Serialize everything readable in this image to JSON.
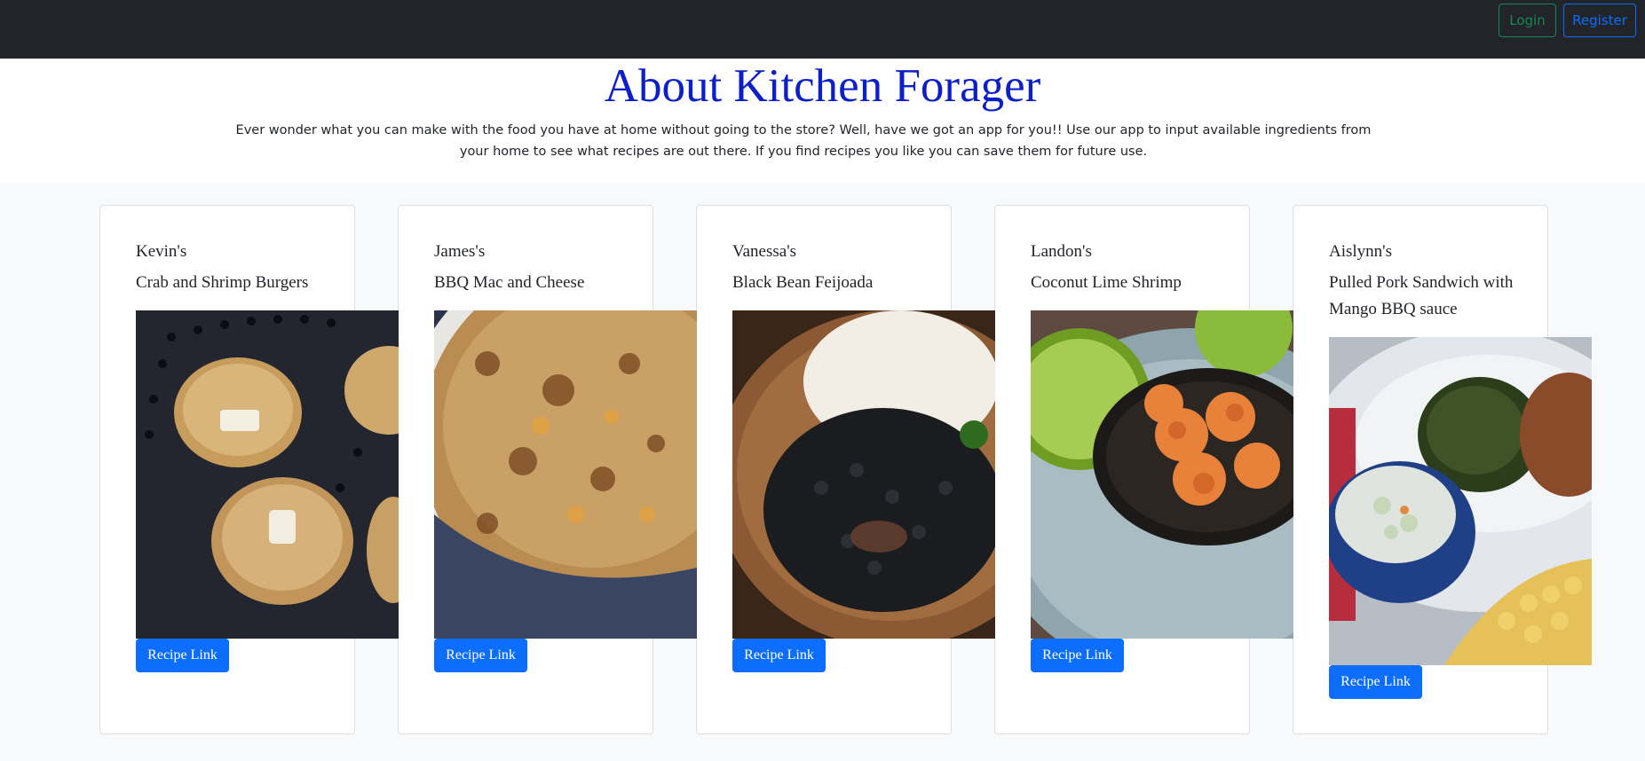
{
  "nav": {
    "login_label": "Login",
    "register_label": "Register"
  },
  "about": {
    "title": "About Kitchen Forager",
    "text": "Ever wonder what you can make with the food you have at home without going to the store? Well, have we got an app for you!! Use our app to input available ingredients from your home to see what recipes are out there. If you find recipes you like you can save them for future use."
  },
  "colors": {
    "navbar": "#212529",
    "title": "#0d1fc8",
    "login": "#198754",
    "register": "#0d6efd",
    "recipe_button": "#0d6efd"
  },
  "cards": [
    {
      "name": "Kevin's",
      "recipe": "Crab and Shrimp Burgers",
      "image": "crab-shrimp-burgers-photo",
      "button": "Recipe Link"
    },
    {
      "name": "James's",
      "recipe": "BBQ Mac and Cheese",
      "image": "bbq-mac-and-cheese-photo",
      "button": "Recipe Link"
    },
    {
      "name": "Vanessa's",
      "recipe": "Black Bean Feijoada",
      "image": "black-bean-feijoada-photo",
      "button": "Recipe Link"
    },
    {
      "name": "Landon's",
      "recipe": "Coconut Lime Shrimp",
      "image": "coconut-lime-shrimp-photo",
      "button": "Recipe Link"
    },
    {
      "name": "Aislynn's",
      "recipe": "Pulled Pork Sandwich with Mango BBQ sauce",
      "image": "pulled-pork-sandwich-photo",
      "button": "Recipe Link"
    }
  ]
}
